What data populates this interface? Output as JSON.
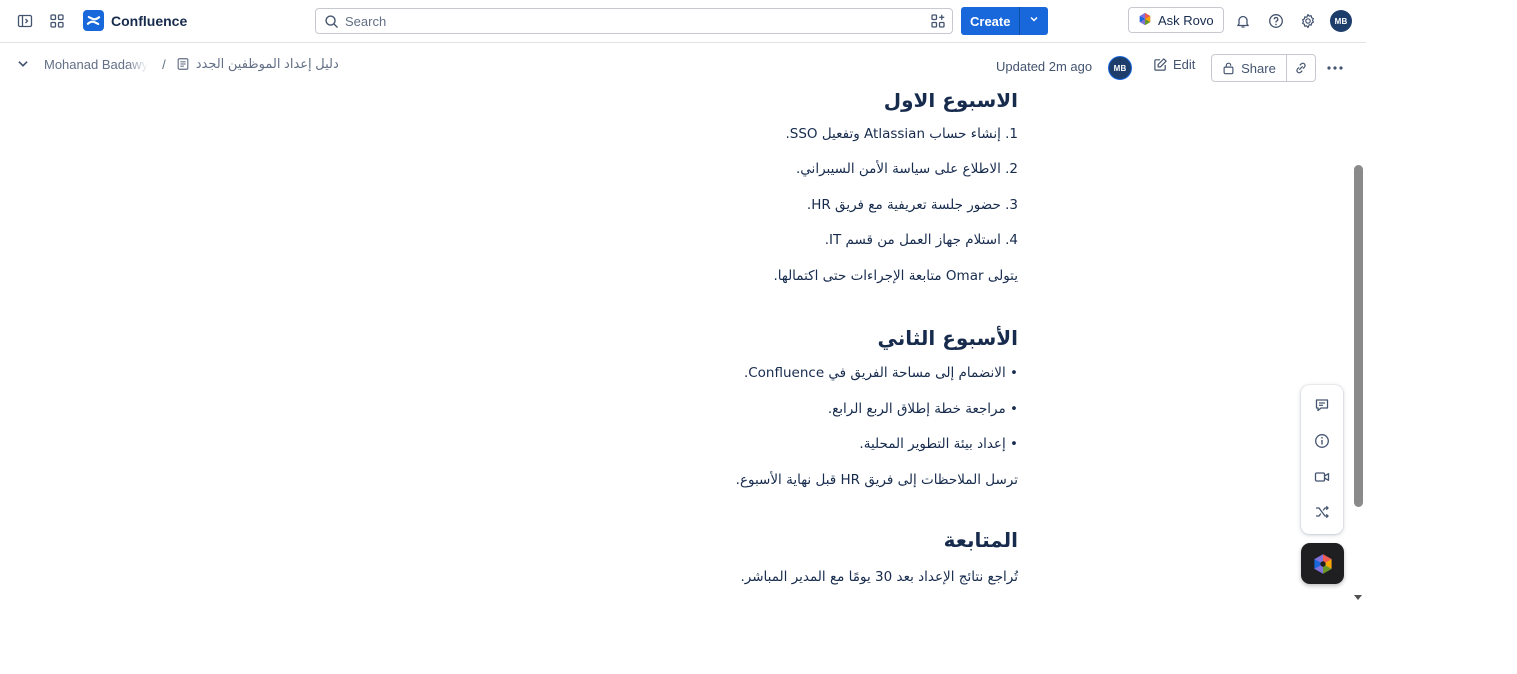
{
  "app": {
    "name": "Confluence",
    "colors": {
      "brand": "#1868db",
      "text": "#172b4d",
      "subtle": "#44546f"
    }
  },
  "topnav": {
    "search_placeholder": "Search",
    "create_label": "Create",
    "ask_rovo_label": "Ask Rovo",
    "avatar_initials": "MB",
    "icons": [
      "sidebar-toggle-icon",
      "app-switcher-icon",
      "search-icon",
      "search-filter-icon",
      "chevron-down-icon",
      "rovo-icon",
      "bell-icon",
      "help-icon",
      "gear-icon"
    ]
  },
  "page_header": {
    "space_name": "Mohanad Badawy",
    "separator": "/",
    "page_title": "دليل إعداد الموظفين الجدد",
    "updated": "Updated 2m ago",
    "avatar_initials": "MB",
    "edit_label": "Edit",
    "share_label": "Share"
  },
  "document": {
    "week1_heading": "الأسبوع الأول",
    "week1_items": [
      "1. إنشاء حساب Atlassian وتفعيل SSO.",
      "2. الاطلاع على سياسة الأمن السيبراني.",
      "3. حضور جلسة تعريفية مع فريق HR.",
      "4. استلام جهاز العمل من قسم IT."
    ],
    "week1_note": "يتولى Omar متابعة الإجراءات حتى اكتمالها.",
    "week2_heading": "الأسبوع الثاني",
    "week2_items": [
      "• الانضمام إلى مساحة الفريق في Confluence.",
      "• مراجعة خطة إطلاق الربع الرابع.",
      "• إعداد بيئة التطوير المحلية."
    ],
    "week2_note": "ترسل الملاحظات إلى فريق HR قبل نهاية الأسبوع.",
    "followup_heading": "المتابعة",
    "followup_text": "تُراجع نتائج الإعداد بعد 30 يومًا مع المدير المباشر."
  },
  "floating_toolbar": {
    "icons": [
      "comment-icon",
      "info-icon",
      "video-icon",
      "shuffle-icon",
      "rovo-icon"
    ]
  }
}
